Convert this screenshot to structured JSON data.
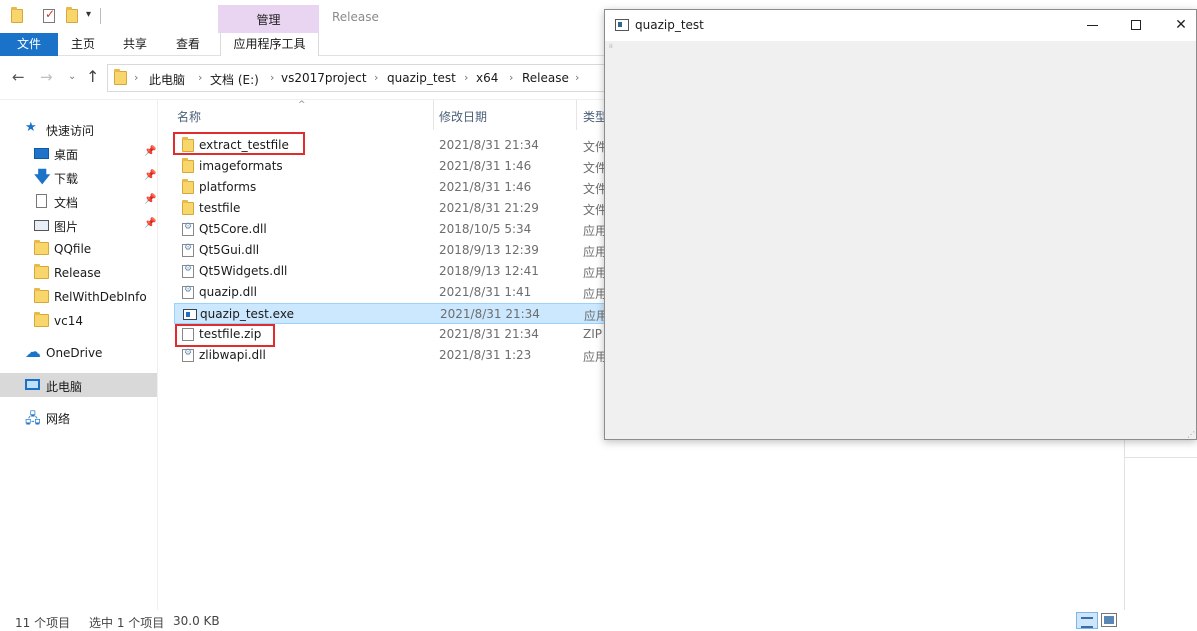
{
  "ribbon": {
    "quick_access_dropdown": "▾",
    "tool_group_label": "管理",
    "window_title": "Release",
    "tabs": {
      "file": "文件",
      "home": "主页",
      "share": "共享",
      "view": "查看",
      "app_tools": "应用程序工具"
    }
  },
  "nav": {
    "back": "←",
    "forward": "→",
    "recent": "⌄",
    "up": "↑",
    "breadcrumb": [
      "此电脑",
      "文档 (E:)",
      "vs2017project",
      "quazip_test",
      "x64",
      "Release"
    ],
    "crumb_sep": "›"
  },
  "sidebar": {
    "quick_access": "快速访问",
    "pin_glyph": "📌",
    "items": [
      {
        "label": "桌面",
        "icon": "desktop-icon",
        "pinned": true
      },
      {
        "label": "下载",
        "icon": "download-icon",
        "pinned": true
      },
      {
        "label": "文档",
        "icon": "document-icon",
        "pinned": true
      },
      {
        "label": "图片",
        "icon": "picture-icon",
        "pinned": true
      },
      {
        "label": "QQfile",
        "icon": "folder-icon",
        "pinned": false
      },
      {
        "label": "Release",
        "icon": "folder-icon",
        "pinned": false
      },
      {
        "label": "RelWithDebInfo",
        "icon": "folder-icon",
        "pinned": false
      },
      {
        "label": "vc14",
        "icon": "folder-icon",
        "pinned": false
      }
    ],
    "onedrive": "OneDrive",
    "this_pc": "此电脑",
    "network": "网络"
  },
  "file_list": {
    "columns": {
      "name": "名称",
      "date": "修改日期",
      "type": "类型"
    },
    "sort_indicator": "^",
    "files": [
      {
        "name": "extract_testfile",
        "date": "2021/8/31 21:34",
        "type": "文件",
        "icon": "folder-icon"
      },
      {
        "name": "imageformats",
        "date": "2021/8/31 1:46",
        "type": "文件",
        "icon": "folder-icon"
      },
      {
        "name": "platforms",
        "date": "2021/8/31 1:46",
        "type": "文件",
        "icon": "folder-icon"
      },
      {
        "name": "testfile",
        "date": "2021/8/31 21:29",
        "type": "文件",
        "icon": "folder-icon"
      },
      {
        "name": "Qt5Core.dll",
        "date": "2018/10/5 5:34",
        "type": "应用",
        "icon": "dll-icon"
      },
      {
        "name": "Qt5Gui.dll",
        "date": "2018/9/13 12:39",
        "type": "应用",
        "icon": "dll-icon"
      },
      {
        "name": "Qt5Widgets.dll",
        "date": "2018/9/13 12:41",
        "type": "应用",
        "icon": "dll-icon"
      },
      {
        "name": "quazip.dll",
        "date": "2021/8/31 1:41",
        "type": "应用",
        "icon": "dll-icon"
      },
      {
        "name": "quazip_test.exe",
        "date": "2021/8/31 21:34",
        "type": "应用",
        "icon": "exe-icon",
        "selected": true
      },
      {
        "name": "testfile.zip",
        "date": "2021/8/31 21:34",
        "type": "ZIP",
        "icon": "zip-icon"
      },
      {
        "name": "zlibwapi.dll",
        "date": "2021/8/31 1:23",
        "type": "应用",
        "icon": "dll-icon"
      }
    ]
  },
  "status": {
    "item_count": "11 个项目",
    "selection": "选中 1 个项目",
    "size": "30.0 KB"
  },
  "qt_window": {
    "title": "quazip_test",
    "close_glyph": "✕",
    "grip": "⁞⁞",
    "resize_grip": "⋰"
  },
  "colors": {
    "accent": "#1a73c8",
    "highlight_box": "#e02c2c",
    "selection": "#cce8ff",
    "tool_group": "#e9d5f2"
  }
}
